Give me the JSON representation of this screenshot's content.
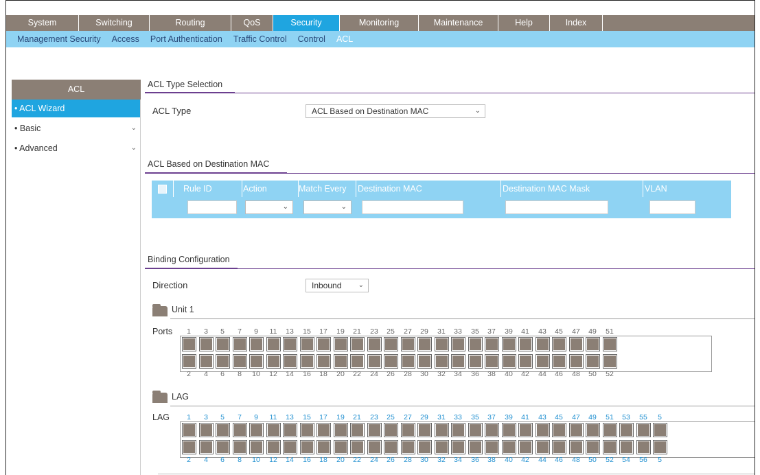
{
  "nav": {
    "tabs": [
      {
        "label": "System",
        "w": 106
      },
      {
        "label": "Switching",
        "w": 103
      },
      {
        "label": "Routing",
        "w": 119
      },
      {
        "label": "QoS",
        "w": 61
      },
      {
        "label": "Security",
        "w": 97,
        "active": true
      },
      {
        "label": "Monitoring",
        "w": 115
      },
      {
        "label": "Maintenance",
        "w": 116
      },
      {
        "label": "Help",
        "w": 75
      },
      {
        "label": "Index",
        "w": 77
      }
    ]
  },
  "subnav": {
    "items": [
      "Management Security",
      "Access",
      "Port Authentication",
      "Traffic Control",
      "Control",
      "ACL"
    ],
    "active": "ACL"
  },
  "sidebar": {
    "title": "ACL",
    "items": [
      {
        "label": "• ACL Wizard",
        "active": true,
        "chevron": false
      },
      {
        "label": "• Basic",
        "active": false,
        "chevron": true
      },
      {
        "label": "• Advanced",
        "active": false,
        "chevron": true
      }
    ]
  },
  "type_section": {
    "title": "ACL Type Selection",
    "acl_type_label": "ACL Type",
    "acl_type_value": "ACL Based on Destination MAC"
  },
  "mac_section": {
    "title": "ACL Based on Destination MAC",
    "columns": [
      "Rule ID",
      "Action",
      "Match Every",
      "Destination MAC",
      "Destination MAC Mask",
      "VLAN"
    ]
  },
  "binding": {
    "title": "Binding Configuration",
    "direction_label": "Direction",
    "direction_value": "Inbound",
    "unit_label": "Unit 1",
    "ports_label": "Ports",
    "lag_title": "LAG",
    "lag_label": "LAG",
    "port_odd": [
      "1",
      "3",
      "5",
      "7",
      "9",
      "11",
      "13",
      "15",
      "17",
      "19",
      "21",
      "23",
      "25",
      "27",
      "29",
      "31",
      "33",
      "35",
      "37",
      "39",
      "41",
      "43",
      "45",
      "47",
      "49",
      "51"
    ],
    "port_even": [
      "2",
      "4",
      "6",
      "8",
      "10",
      "12",
      "14",
      "16",
      "18",
      "20",
      "22",
      "24",
      "26",
      "28",
      "30",
      "32",
      "34",
      "36",
      "38",
      "40",
      "42",
      "44",
      "46",
      "48",
      "50",
      "52"
    ],
    "lag_odd": [
      "1",
      "3",
      "5",
      "7",
      "9",
      "11",
      "13",
      "15",
      "17",
      "19",
      "21",
      "23",
      "25",
      "27",
      "29",
      "31",
      "33",
      "35",
      "37",
      "39",
      "41",
      "43",
      "45",
      "47",
      "49",
      "51",
      "53",
      "55",
      "5"
    ],
    "lag_even": [
      "2",
      "4",
      "6",
      "8",
      "10",
      "12",
      "14",
      "16",
      "18",
      "20",
      "22",
      "24",
      "26",
      "28",
      "30",
      "32",
      "34",
      "36",
      "38",
      "40",
      "42",
      "44",
      "46",
      "48",
      "50",
      "52",
      "54",
      "56",
      "5"
    ]
  }
}
